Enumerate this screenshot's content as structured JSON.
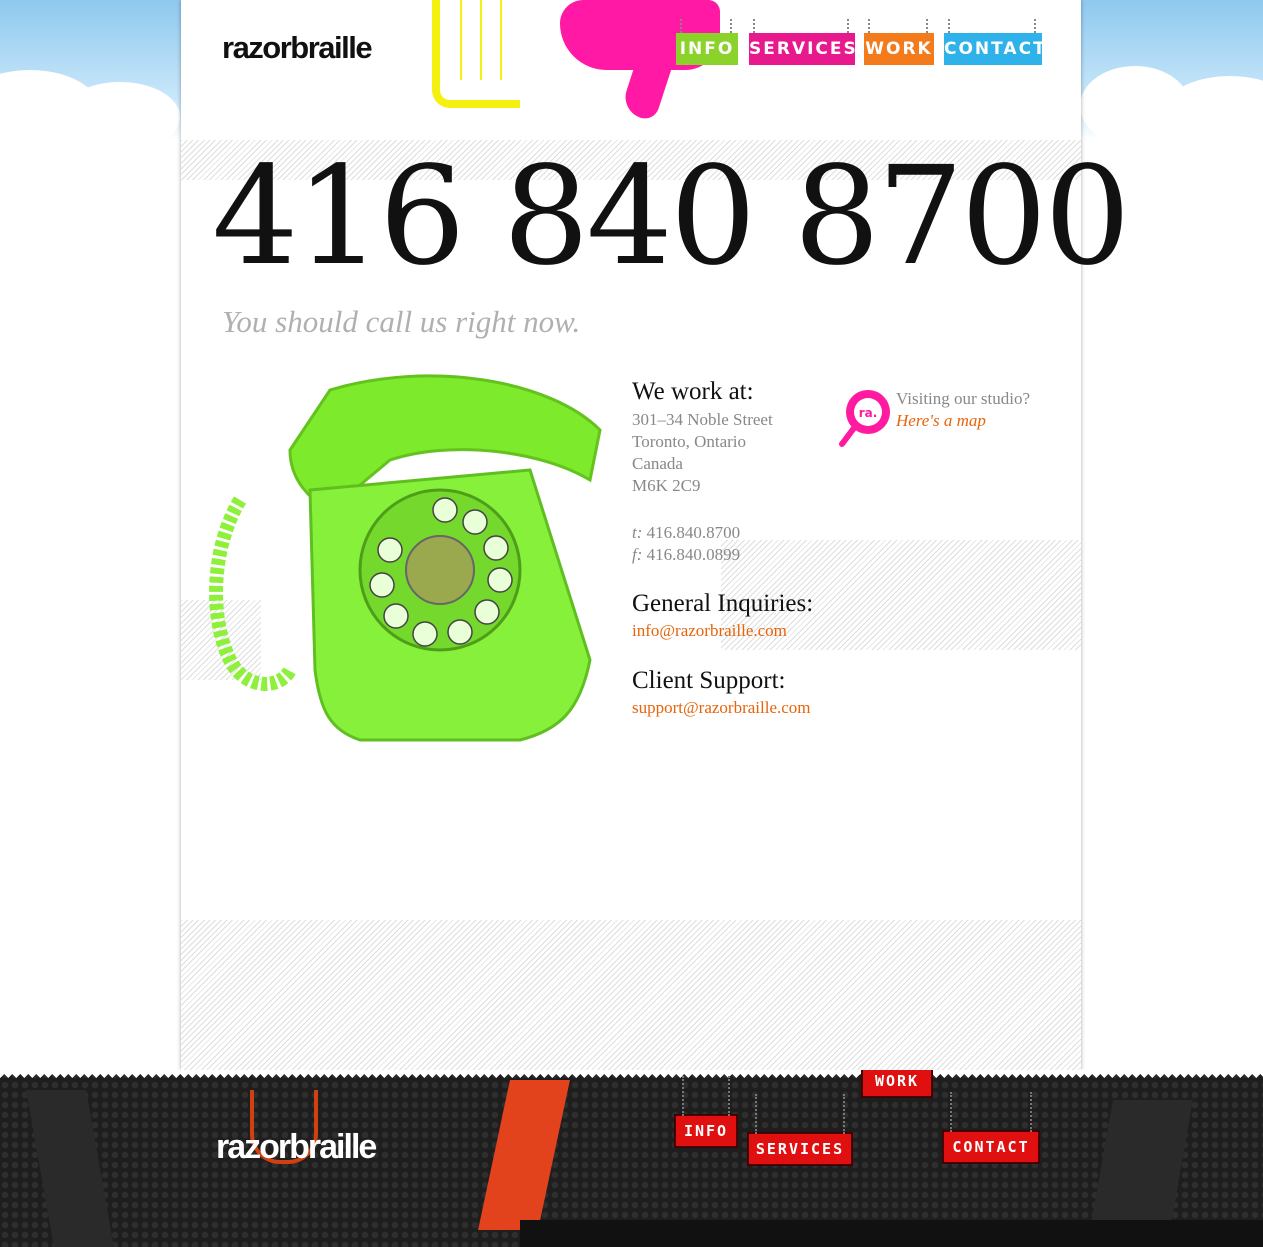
{
  "brand": {
    "logo_text": "razorbraille"
  },
  "nav": {
    "info": "INFO",
    "services": "SERVICES",
    "work": "WORK",
    "contact": "CONTACT"
  },
  "colors": {
    "info": "#8bd22b",
    "services": "#e8198c",
    "work": "#f47b1c",
    "contact": "#2fb1ea",
    "link": "#e8630a"
  },
  "hero": {
    "phone": "416 840 8700",
    "tagline": "You should call us right now."
  },
  "address": {
    "heading": "We work at:",
    "line1": "301–34 Noble Street",
    "line2": "Toronto, Ontario",
    "line3": "Canada",
    "line4": "M6K 2C9"
  },
  "numbers": {
    "tel_label": "t:",
    "tel": "416.840.8700",
    "fax_label": "f:",
    "fax": "416.840.0899"
  },
  "inquiries": {
    "heading": "General Inquiries:",
    "email": "info@razorbraille.com"
  },
  "support": {
    "heading": "Client Support:",
    "email": "support@razorbraille.com"
  },
  "map": {
    "question": "Visiting our studio?",
    "link": "Here's a map",
    "badge_icon": "magnifier-badge-icon",
    "badge_text": "ra."
  },
  "footer": {
    "logo_text": "razorbraille",
    "info": "INFO",
    "services": "SERVICES",
    "work": "WORK",
    "contact": "CONTACT"
  }
}
